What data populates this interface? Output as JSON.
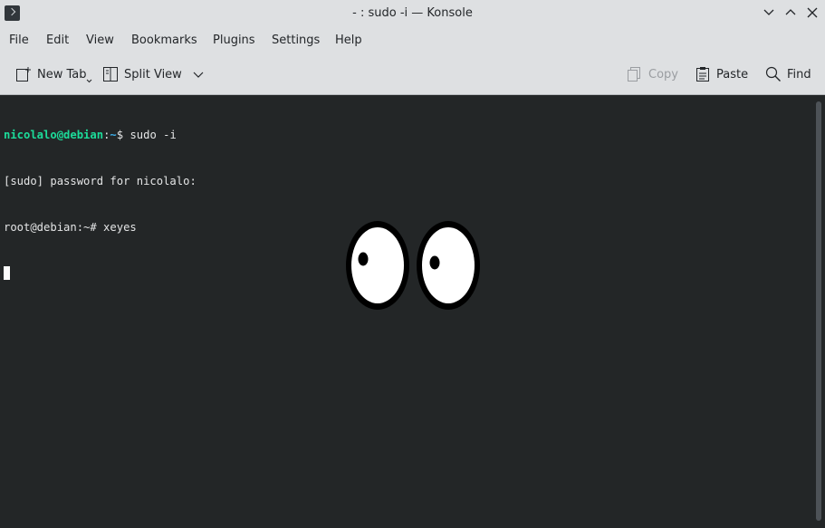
{
  "window": {
    "title": "- : sudo -i — Konsole",
    "icons": {
      "app": "terminal-icon",
      "minimize": "chevron-down-icon",
      "maximize": "chevron-up-icon",
      "close": "close-icon"
    }
  },
  "menubar": {
    "items": [
      "File",
      "Edit",
      "View",
      "Bookmarks",
      "Plugins",
      "Settings",
      "Help"
    ]
  },
  "toolbar": {
    "new_tab": "New Tab",
    "split_view": "Split View",
    "copy": "Copy",
    "paste": "Paste",
    "find": "Find"
  },
  "terminal": {
    "line1": {
      "user_host": "nicolalo@debian",
      "sep": ":",
      "path": "~",
      "prompt": "$ ",
      "command": "sudo -i"
    },
    "line2": "[sudo] password for nicolalo:",
    "line3": "root@debian:~# xeyes"
  },
  "colors": {
    "chrome": "#dee0e2",
    "terminal_bg": "#232627",
    "prompt_user": "#1cdc9a",
    "prompt_path": "#3daee9"
  }
}
